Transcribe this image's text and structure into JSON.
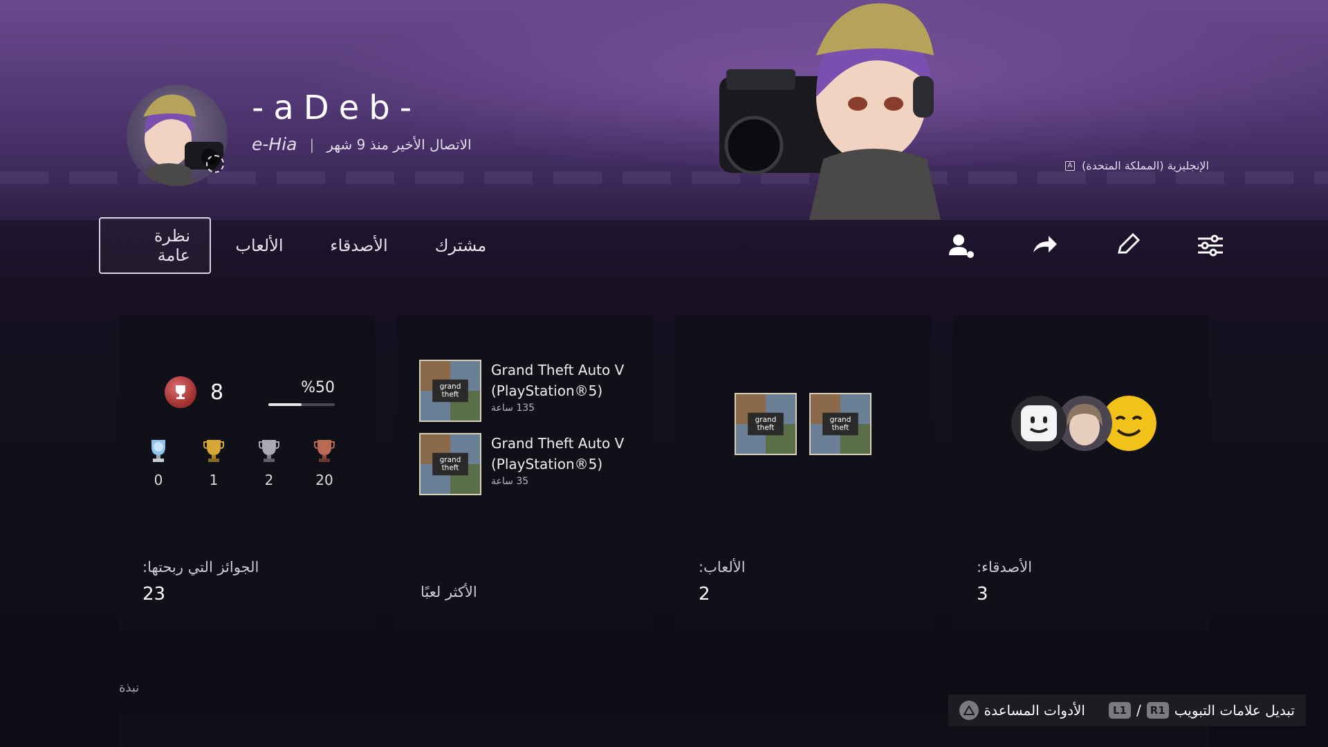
{
  "profile": {
    "online_id": "-aDeb-",
    "real_name": "e-Hia",
    "last_online": "الاتصال الأخير منذ 9 شهر",
    "separator": "|"
  },
  "banner": {
    "language": "الإنجليزية (المملكة المتحدة)",
    "language_icon": "translate-icon"
  },
  "tabs": [
    {
      "label": "نظرة عامة",
      "active": true
    },
    {
      "label": "الألعاب",
      "active": false
    },
    {
      "label": "الأصدقاء",
      "active": false
    },
    {
      "label": "مشترك",
      "active": false
    }
  ],
  "actions": [
    {
      "icon": "add-friend-icon"
    },
    {
      "icon": "share-icon"
    },
    {
      "icon": "edit-icon"
    },
    {
      "icon": "settings-sliders-icon"
    }
  ],
  "trophies": {
    "level": "8",
    "progress_label": "%50",
    "progress_fraction": 0.5,
    "counts": {
      "platinum": "0",
      "gold": "1",
      "silver": "2",
      "bronze": "20"
    },
    "label": "الجوائز التي ربحتها:",
    "total": "23",
    "colors": {
      "level_badge": "#b23a3a",
      "gold": "#c9962c",
      "silver": "#9a9aa3",
      "bronze": "#a85a48",
      "platinum": "#6fa8dc"
    }
  },
  "most_played": {
    "label": "الأكثر لعبًا",
    "games": [
      {
        "title_line1": "Grand Theft Auto V",
        "title_line2": "(PlayStation®5)",
        "hours": "135 ساعة"
      },
      {
        "title_line1": "Grand Theft Auto V",
        "title_line2": "(PlayStation®5)",
        "hours": "35 ساعة"
      }
    ]
  },
  "games": {
    "label": "الألعاب:",
    "count": "2"
  },
  "friends": {
    "label": "الأصدقاء:",
    "count": "3"
  },
  "about": {
    "label": "نبذة"
  },
  "hints": {
    "switch_tabs": "تبديل علامات التبويب",
    "r1": "R1",
    "l1": "L1",
    "slash": "/",
    "accessibility": "الأدوات المساعدة"
  }
}
